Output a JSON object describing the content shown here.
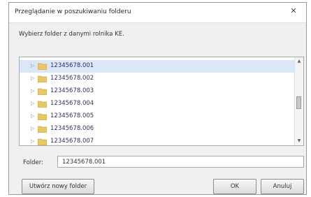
{
  "dialog": {
    "title": "Przeglądanie w poszukiwaniu folderu",
    "close_label": "✕",
    "instruction": "Wybierz folder z danymi rolnika KE."
  },
  "tree": {
    "items": [
      {
        "label": "12345678.001",
        "selected": true
      },
      {
        "label": "12345678.002",
        "selected": false
      },
      {
        "label": "12345678.003",
        "selected": false
      },
      {
        "label": "12345678.004",
        "selected": false
      },
      {
        "label": "12345678.005",
        "selected": false
      },
      {
        "label": "12345678.006",
        "selected": false
      },
      {
        "label": "12345678.007",
        "selected": false
      }
    ],
    "expand_glyph": "▷",
    "folder_icon": "folder-icon"
  },
  "scrollbar": {
    "up_glyph": "▲",
    "down_glyph": "▼"
  },
  "folder_field": {
    "label": "Folder:",
    "value": "12345678.001"
  },
  "buttons": {
    "new_folder": "Utwórz nowy folder",
    "ok": "OK",
    "cancel": "Anuluj"
  },
  "colors": {
    "dialog_bg": "#f0f0f0",
    "selection": "#d9e7f7",
    "folder_yellow": "#e8c766"
  }
}
